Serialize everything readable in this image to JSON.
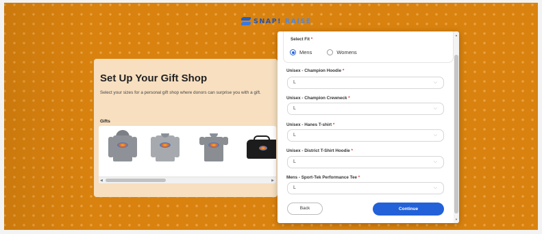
{
  "brand": {
    "name_part1": "SNAP!",
    "name_part2": "RAISE"
  },
  "gift_shop": {
    "title": "Set Up Your Gift Shop",
    "description": "Select your sizes for a personal gift shop where donors can surprise you with a gift.",
    "gifts_label": "Gifts",
    "gifts": [
      {
        "name": "Hoodie",
        "icon": "hoodie-icon"
      },
      {
        "name": "Crewneck",
        "icon": "crewneck-icon"
      },
      {
        "name": "T-shirt",
        "icon": "tshirt-icon"
      },
      {
        "name": "Duffel bag",
        "icon": "bag-icon"
      }
    ]
  },
  "form": {
    "fit": {
      "label": "Select Fit",
      "required": "*",
      "options": [
        "Mens",
        "Womens"
      ],
      "selected": "Mens"
    },
    "fields": [
      {
        "label": "Unisex - Champion Hoodie",
        "value": "L"
      },
      {
        "label": "Unisex - Champion Crewneck",
        "value": "L"
      },
      {
        "label": "Unisex - Hanes T-shirt",
        "value": "L"
      },
      {
        "label": "Unisex - District T-Shirt Hoodie",
        "value": "L"
      },
      {
        "label": "Mens - Sport-Tek Performance Tee",
        "value": "L"
      }
    ],
    "required_mark": "*",
    "back_label": "Back",
    "continue_label": "Continue"
  },
  "colors": {
    "background": "#d9820f",
    "card": "#f7dfc0",
    "primary": "#2261d8",
    "required": "#e0342c"
  }
}
